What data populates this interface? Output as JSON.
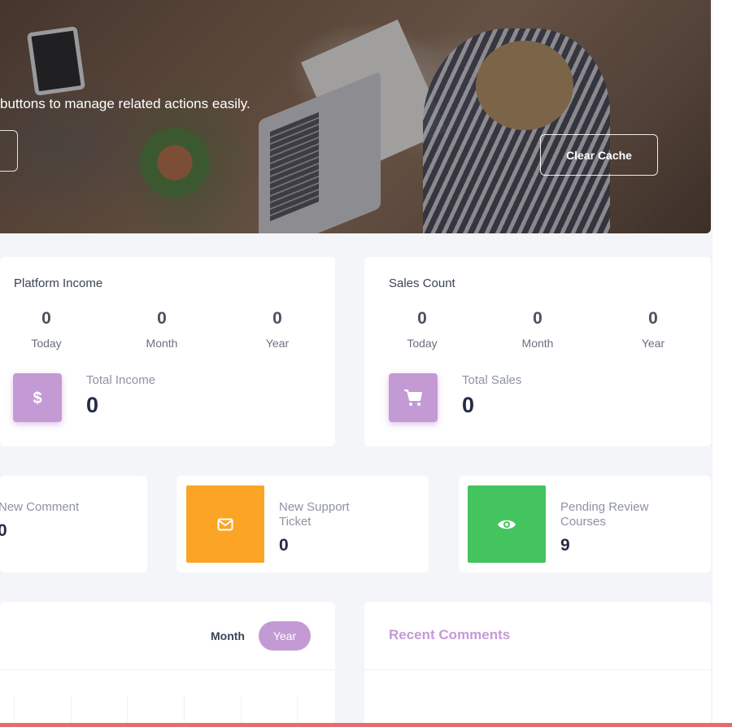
{
  "hero": {
    "text": "buttons to manage related actions easily.",
    "clear_cache_label": "Clear Cache"
  },
  "platform_income": {
    "title": "Platform Income",
    "stats": [
      {
        "value": "0",
        "label": "Today"
      },
      {
        "value": "0",
        "label": "Month"
      },
      {
        "value": "0",
        "label": "Year"
      }
    ],
    "total_label": "Total Income",
    "total_value": "0",
    "icon": "dollar-icon"
  },
  "sales_count": {
    "title": "Sales Count",
    "stats": [
      {
        "value": "0",
        "label": "Today"
      },
      {
        "value": "0",
        "label": "Month"
      },
      {
        "value": "0",
        "label": "Year"
      }
    ],
    "total_label": "Total Sales",
    "total_value": "0",
    "icon": "cart-icon"
  },
  "mini_cards": [
    {
      "label": "New Comment",
      "value": "0"
    },
    {
      "label": "New Support Ticket",
      "value": "0",
      "icon": "envelope-icon",
      "color": "#fca425"
    },
    {
      "label": "Pending Review Courses",
      "value": "9",
      "icon": "eye-icon",
      "color": "#44c45e"
    }
  ],
  "chart_card": {
    "tabs": [
      {
        "label": "Month",
        "active": false
      },
      {
        "label": "Year",
        "active": true
      }
    ]
  },
  "recent_comments": {
    "title": "Recent Comments"
  },
  "colors": {
    "accent": "#c49ad5",
    "orange": "#fca425",
    "green": "#44c45e",
    "bottom_bar": "#e96a6a"
  }
}
